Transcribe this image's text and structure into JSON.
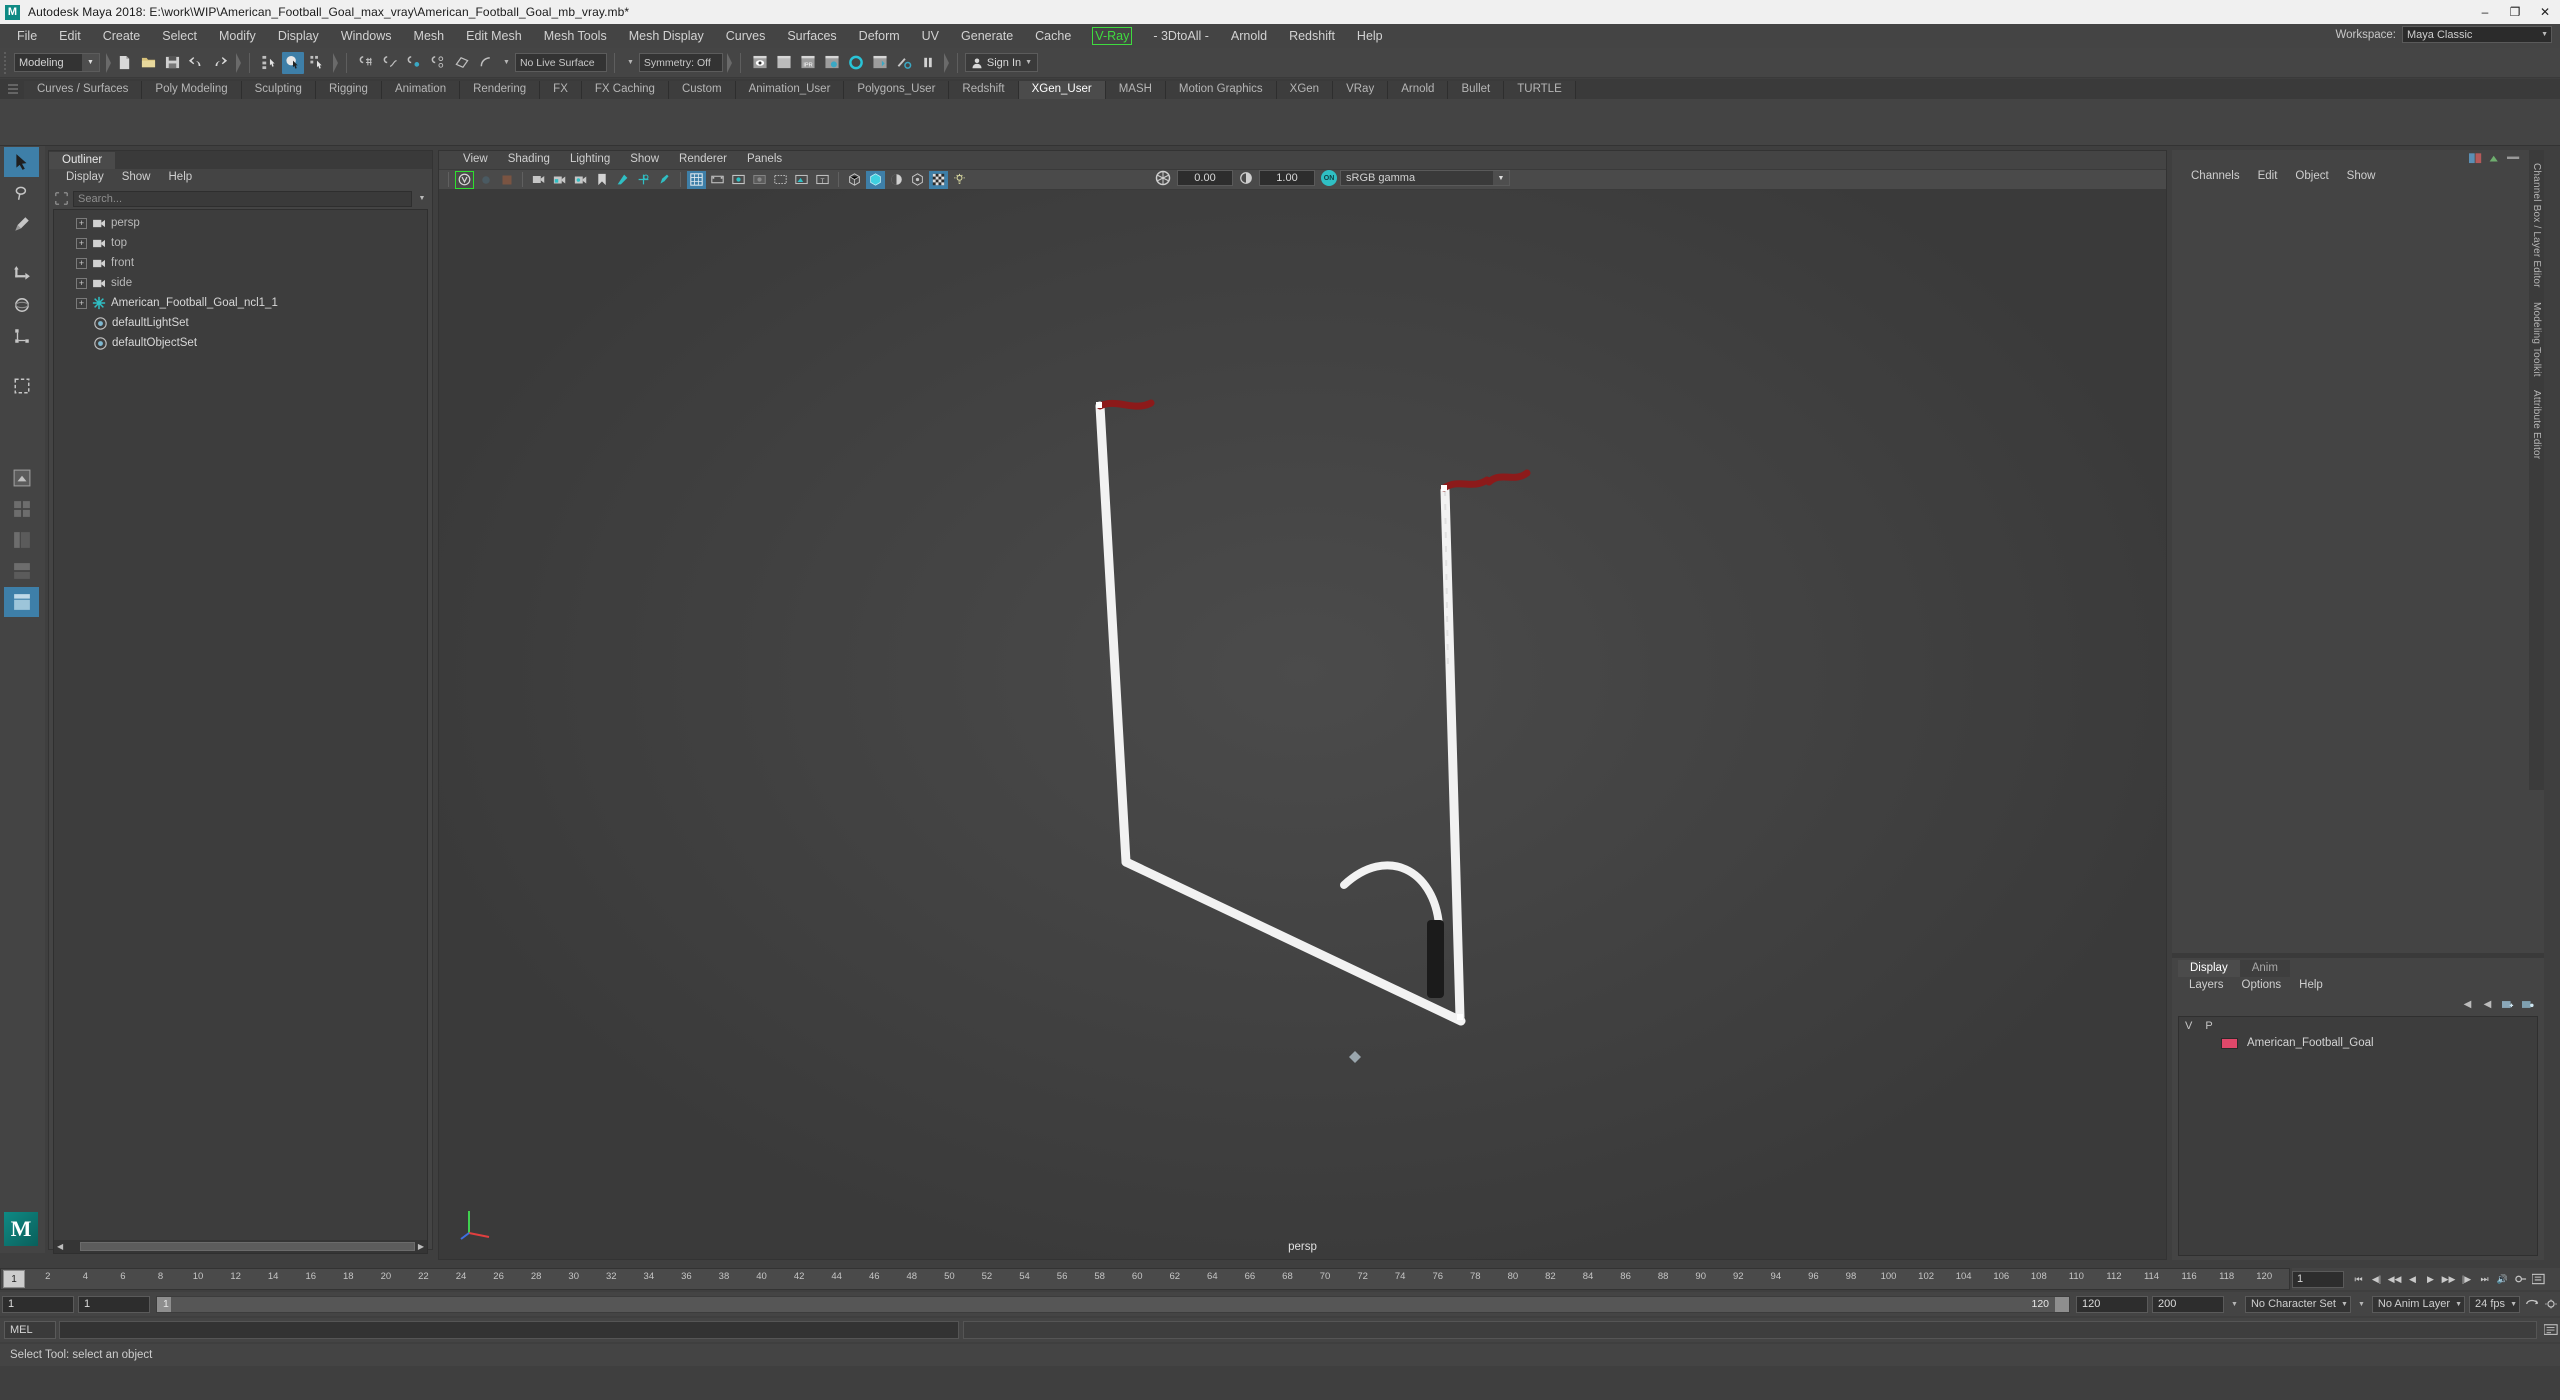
{
  "window": {
    "app_icon": "maya-logo-icon",
    "title": "Autodesk Maya 2018: E:\\work\\WIP\\American_Football_Goal_max_vray\\American_Football_Goal_mb_vray.mb*",
    "minimize": "–",
    "maximize": "❐",
    "close": "✕"
  },
  "menubar": {
    "items": [
      {
        "label": "File"
      },
      {
        "label": "Edit"
      },
      {
        "label": "Create"
      },
      {
        "label": "Select"
      },
      {
        "label": "Modify"
      },
      {
        "label": "Display"
      },
      {
        "label": "Windows"
      },
      {
        "label": "Mesh"
      },
      {
        "label": "Edit Mesh"
      },
      {
        "label": "Mesh Tools"
      },
      {
        "label": "Mesh Display"
      },
      {
        "label": "Curves"
      },
      {
        "label": "Surfaces"
      },
      {
        "label": "Deform"
      },
      {
        "label": "UV"
      },
      {
        "label": "Generate"
      },
      {
        "label": "Cache"
      },
      {
        "label": "V-Ray",
        "highlight": true
      },
      {
        "label": "- 3DtoAll -"
      },
      {
        "label": "Arnold"
      },
      {
        "label": "Redshift"
      },
      {
        "label": "Help"
      }
    ],
    "workspace_label": "Workspace:",
    "workspace_value": "Maya Classic"
  },
  "toolbar": {
    "mode": "Modeling",
    "live_surface": "No Live Surface",
    "symmetry": "Symmetry: Off",
    "signin": "Sign In",
    "icons": [
      "new-scene-icon",
      "open-scene-icon",
      "save-scene-icon",
      "undo-icon",
      "redo-icon",
      "select-by-hierarchy-icon",
      "select-by-object-icon",
      "select-by-component-icon",
      "snap-to-grid-icon",
      "snap-to-curve-icon",
      "snap-to-point-icon",
      "snap-to-projected-center-icon",
      "snap-to-view-plane-icon",
      "make-live-icon",
      "render-view-icon",
      "render-sequence-icon",
      "ipr-render-icon",
      "render-settings-icon",
      "hypershade-icon",
      "render-setup-icon",
      "toggle-rendering-icon",
      "pause-icon"
    ]
  },
  "shelf": {
    "tabs": [
      "Curves / Surfaces",
      "Poly Modeling",
      "Sculpting",
      "Rigging",
      "Animation",
      "Rendering",
      "FX",
      "FX Caching",
      "Custom",
      "Animation_User",
      "Polygons_User",
      "Redshift",
      "XGen_User",
      "MASH",
      "Motion Graphics",
      "XGen",
      "VRay",
      "Arnold",
      "Bullet",
      "TURTLE"
    ],
    "active": "XGen_User"
  },
  "toolbox": {
    "items": [
      "select-tool-icon",
      "lasso-tool-icon",
      "paint-select-tool-icon",
      "move-tool-icon",
      "rotate-tool-icon",
      "scale-tool-icon",
      "last-tool-icon",
      "show-manipulator-icon",
      "single-perspective-layout-icon",
      "four-view-layout-icon",
      "persp-outliner-layout-icon",
      "persp-graph-layout-icon",
      "hypershade-layout-icon"
    ]
  },
  "outliner": {
    "tab": "Outliner",
    "menu": [
      "Display",
      "Show",
      "Help"
    ],
    "search_placeholder": "Search...",
    "search_icon": "search-icon",
    "items": [
      {
        "label": "persp",
        "icon": "camera-icon",
        "expandable": true,
        "dim": true
      },
      {
        "label": "top",
        "icon": "camera-icon",
        "expandable": true,
        "dim": true
      },
      {
        "label": "front",
        "icon": "camera-icon",
        "expandable": true,
        "dim": true
      },
      {
        "label": "side",
        "icon": "camera-icon",
        "expandable": true,
        "dim": true
      },
      {
        "label": "American_Football_Goal_ncl1_1",
        "icon": "nucleus-icon",
        "expandable": true,
        "dim": false
      },
      {
        "label": "defaultLightSet",
        "icon": "set-icon",
        "expandable": false,
        "dim": false
      },
      {
        "label": "defaultObjectSet",
        "icon": "set-icon",
        "expandable": false,
        "dim": false
      }
    ]
  },
  "viewport": {
    "menu": [
      "View",
      "Shading",
      "Lighting",
      "Show",
      "Renderer",
      "Panels"
    ],
    "exposure": "0.00",
    "gamma_value": "1.00",
    "color_profile": "sRGB gamma",
    "camera_label": "persp",
    "toolbar_icons": [
      "vray-vfb-icon",
      "select-camera-icon",
      "bookmark-icon",
      "camera-attributes-icon",
      "lock-camera-icon",
      "camera-settings-icon",
      "image-plane-icon",
      "two-d-pan-zoom-icon",
      "grease-pencil-icon",
      "grid-toggle-icon",
      "film-gate-icon",
      "resolution-gate-icon",
      "gate-mask-icon",
      "xray-joints-icon",
      "xray-icon",
      "texture-icon",
      "wireframe-icon",
      "smooth-shade-icon",
      "shaded-textured-icon",
      "lighting-icon",
      "shadows-icon",
      "screen-space-ao-icon",
      "motion-blur-icon",
      "multisample-icon",
      "isolate-select-icon"
    ],
    "scene": {
      "object": "American Football Goal",
      "post_color": "#f2f2f2",
      "flag_color": "#8c1a1a",
      "base_color": "#1a1a1a"
    }
  },
  "right_panel": {
    "channels_menu": [
      "Channels",
      "Edit",
      "Object",
      "Show"
    ],
    "side_tabs": [
      "Channel Box / Layer Editor",
      "Modeling Toolkit",
      "Attribute Editor"
    ],
    "layer_tabs": [
      "Display",
      "Anim"
    ],
    "layer_tabs_active": "Display",
    "layer_menu": [
      "Layers",
      "Options",
      "Help"
    ],
    "layer_headers": [
      "V",
      "P"
    ],
    "layers": [
      {
        "name": "American_Football_Goal",
        "color": "#e0486a",
        "visible": "",
        "playback": ""
      }
    ]
  },
  "timeline": {
    "current_frame": "1",
    "ticks": [
      "2",
      "4",
      "6",
      "8",
      "10",
      "12",
      "14",
      "16",
      "18",
      "20",
      "22",
      "24",
      "26",
      "28",
      "30",
      "32",
      "34",
      "36",
      "38",
      "40",
      "42",
      "44",
      "46",
      "48",
      "50",
      "52",
      "54",
      "56",
      "58",
      "60",
      "62",
      "64",
      "66",
      "68",
      "70",
      "72",
      "74",
      "76",
      "78",
      "80",
      "82",
      "84",
      "86",
      "88",
      "90",
      "92",
      "94",
      "96",
      "98",
      "100",
      "102",
      "104",
      "106",
      "108",
      "110",
      "112",
      "114",
      "116",
      "118",
      "120"
    ],
    "end_field": "1",
    "playback_icons": [
      "go-to-start-icon",
      "step-back-frame-icon",
      "step-back-key-icon",
      "play-backwards-icon",
      "play-forwards-icon",
      "step-forward-key-icon",
      "step-forward-frame-icon",
      "go-to-end-icon"
    ],
    "sound_icon": "sound-icon",
    "autokey_icon": "auto-key-icon",
    "anim-prefs-icon": "animation-preferences-icon"
  },
  "range": {
    "start": "1",
    "range_start": "1",
    "inner_start": "1",
    "inner_end": "120",
    "range_end": "120",
    "end": "200",
    "character_set": "No Character Set",
    "anim_layer": "No Anim Layer",
    "fps": "24 fps"
  },
  "command_line": {
    "language": "MEL",
    "input_value": "",
    "output_value": ""
  },
  "status": {
    "message": "Select Tool: select an object"
  }
}
